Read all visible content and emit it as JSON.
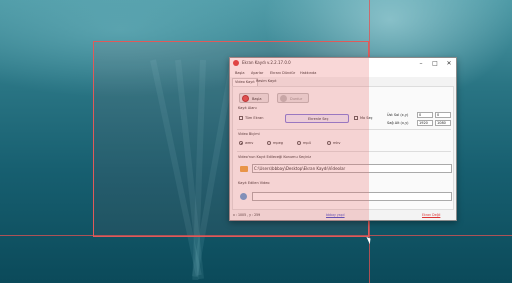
{
  "window": {
    "title": "Ekran Kaydı v.2.2.17.0.0",
    "buttons": {
      "minimize": "–",
      "maximize": "□",
      "close": "✕"
    }
  },
  "menu": {
    "items": [
      "Başla",
      "Ayarlar",
      "Ekranı Dündür",
      "Hakkında"
    ]
  },
  "tabs": [
    "Video Kayıt",
    "Resim Kayıt"
  ],
  "controls": {
    "start_label": "Başla",
    "stop_label": "Durdur"
  },
  "record_area": {
    "section_label": "Kayıt Alanı",
    "full_screen_label": "Tüm Ekran",
    "select_area_label": "Ekrenle Seç",
    "mouse_label": "Mo Seç",
    "start_point_label": "Üst Sol (x,y)",
    "size_label": "Sağ Alt (x,y)",
    "x1": "0",
    "y1": "0",
    "x2": "1920",
    "y2": "1080"
  },
  "video_format": {
    "section_label": "Video Biçimi",
    "options": [
      "wmv",
      "mpeg",
      "mp4",
      "mkv"
    ],
    "selected": "wmv"
  },
  "save_location": {
    "section_label": "Video'nun Kayıt Edileceği Konumu Seçiniz",
    "path": "C:\\Users\\bbbay\\Desktop\\Ekran Kaydı\\Videolar"
  },
  "recorded_video": {
    "section_label": "Kayıt Edilen Video"
  },
  "status": {
    "coords": "x : 1005 , y : 259",
    "link": "bbbay yapıl",
    "right": "Ekran Değil"
  }
}
